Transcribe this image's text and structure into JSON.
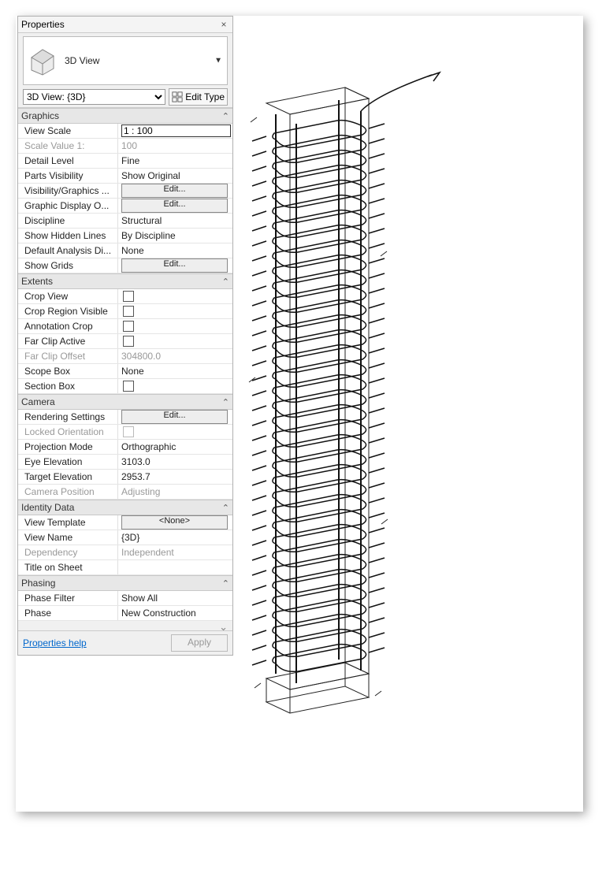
{
  "panel": {
    "title": "Properties",
    "close_glyph": "×",
    "family": {
      "name": "3D View",
      "dropdown_glyph": "▼"
    },
    "selector": {
      "selected": "3D View: {3D}"
    },
    "edit_type": {
      "label": "Edit Type"
    },
    "sections": {
      "graphics": {
        "title": "Graphics",
        "rows": {
          "view_scale": {
            "label": "View Scale",
            "value": "1 : 100"
          },
          "scale_value": {
            "label": "Scale Value    1:",
            "value": "100"
          },
          "detail_level": {
            "label": "Detail Level",
            "value": "Fine"
          },
          "parts_visibility": {
            "label": "Parts Visibility",
            "value": "Show Original"
          },
          "vis_graphics": {
            "label": "Visibility/Graphics ...",
            "button": "Edit..."
          },
          "graphic_display": {
            "label": "Graphic Display O...",
            "button": "Edit..."
          },
          "discipline": {
            "label": "Discipline",
            "value": "Structural"
          },
          "show_hidden_lines": {
            "label": "Show Hidden Lines",
            "value": "By Discipline"
          },
          "default_analysis": {
            "label": "Default Analysis Di...",
            "value": "None"
          },
          "show_grids": {
            "label": "Show Grids",
            "button": "Edit..."
          }
        }
      },
      "extents": {
        "title": "Extents",
        "rows": {
          "crop_view": {
            "label": "Crop View"
          },
          "crop_region_visible": {
            "label": "Crop Region Visible"
          },
          "annotation_crop": {
            "label": "Annotation Crop"
          },
          "far_clip_active": {
            "label": "Far Clip Active"
          },
          "far_clip_offset": {
            "label": "Far Clip Offset",
            "value": "304800.0"
          },
          "scope_box": {
            "label": "Scope Box",
            "value": "None"
          },
          "section_box": {
            "label": "Section Box"
          }
        }
      },
      "camera": {
        "title": "Camera",
        "rows": {
          "rendering_settings": {
            "label": "Rendering Settings",
            "button": "Edit..."
          },
          "locked_orientation": {
            "label": "Locked Orientation"
          },
          "projection_mode": {
            "label": "Projection Mode",
            "value": "Orthographic"
          },
          "eye_elevation": {
            "label": "Eye Elevation",
            "value": "3103.0"
          },
          "target_elevation": {
            "label": "Target Elevation",
            "value": "2953.7"
          },
          "camera_position": {
            "label": "Camera Position",
            "value": "Adjusting"
          }
        }
      },
      "identity": {
        "title": "Identity Data",
        "rows": {
          "view_template": {
            "label": "View Template",
            "button": "<None>"
          },
          "view_name": {
            "label": "View Name",
            "value": "{3D}"
          },
          "dependency": {
            "label": "Dependency",
            "value": "Independent"
          },
          "title_on_sheet": {
            "label": "Title on Sheet",
            "value": ""
          }
        }
      },
      "phasing": {
        "title": "Phasing",
        "rows": {
          "phase_filter": {
            "label": "Phase Filter",
            "value": "Show All"
          },
          "phase": {
            "label": "Phase",
            "value": "New Construction"
          }
        }
      }
    },
    "footer": {
      "help": "Properties help",
      "apply": "Apply"
    }
  },
  "collapse_glyph": "☰"
}
